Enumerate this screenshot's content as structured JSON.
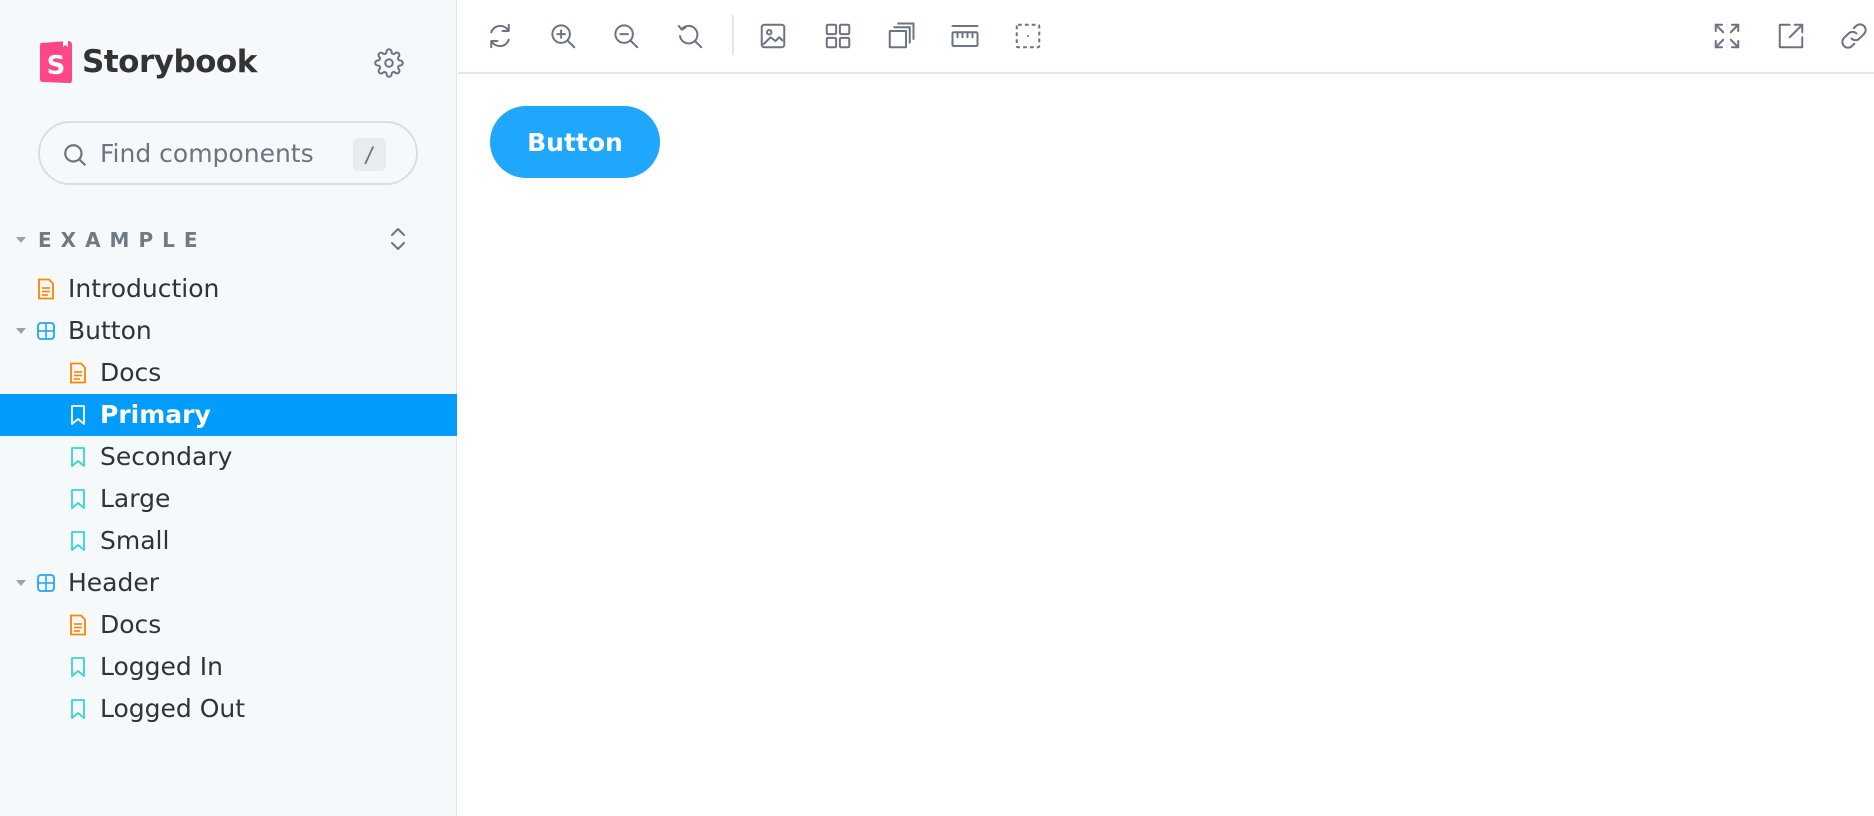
{
  "app": {
    "name": "Storybook"
  },
  "search": {
    "placeholder": "Find components",
    "shortcut": "/"
  },
  "section": {
    "title": "EXAMPLE"
  },
  "tree": {
    "introduction": "Introduction",
    "button": {
      "label": "Button",
      "docs": "Docs",
      "primary": "Primary",
      "secondary": "Secondary",
      "large": "Large",
      "small": "Small"
    },
    "header": {
      "label": "Header",
      "docs": "Docs",
      "logged_in": "Logged In",
      "logged_out": "Logged Out"
    }
  },
  "toolbar": {
    "left_icons": [
      "reload-icon",
      "zoom-in-icon",
      "zoom-out-icon",
      "zoom-reset-icon",
      "background-icon",
      "grid-icon",
      "outline-icon",
      "measure-icon",
      "viewport-icon"
    ],
    "right_icons": [
      "fullscreen-icon",
      "open-new-tab-icon",
      "copy-link-icon"
    ]
  },
  "preview": {
    "button_label": "Button"
  },
  "colors": {
    "accent": "#029cfd",
    "story_button": "#1ea7fd",
    "brand_pink": "#ff4785",
    "docs_icon": "#ff8300",
    "story_icon": "#37d5d3",
    "component_icon": "#1ea7fd"
  }
}
